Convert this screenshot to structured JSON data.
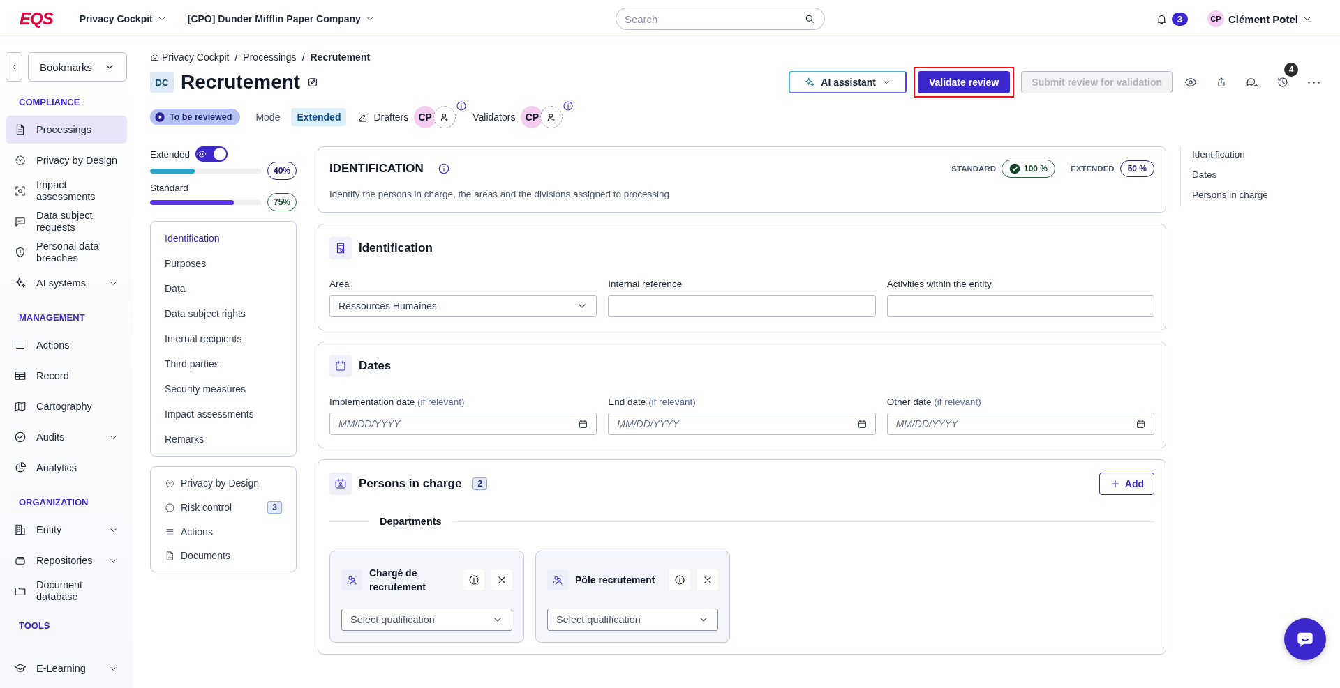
{
  "header": {
    "logo": "EQS",
    "module": "Privacy Cockpit",
    "company": "[CPO] Dunder Mifflin Paper Company",
    "search": {
      "placeholder": "Search"
    },
    "notifications": "3",
    "user": {
      "initials": "CP",
      "name": "Clément Potel"
    }
  },
  "sidebar": {
    "bookmarks": "Bookmarks",
    "sections": [
      {
        "title": "COMPLIANCE",
        "items": [
          {
            "label": "Processings",
            "selected": true,
            "expandable": false
          },
          {
            "label": "Privacy by Design",
            "selected": false,
            "expandable": false
          },
          {
            "label": "Impact assessments",
            "selected": false,
            "expandable": false
          },
          {
            "label": "Data subject requests",
            "selected": false,
            "expandable": false
          },
          {
            "label": "Personal data breaches",
            "selected": false,
            "expandable": false
          },
          {
            "label": "AI systems",
            "selected": false,
            "expandable": true
          }
        ]
      },
      {
        "title": "MANAGEMENT",
        "items": [
          {
            "label": "Actions",
            "selected": false,
            "expandable": false
          },
          {
            "label": "Record",
            "selected": false,
            "expandable": false
          },
          {
            "label": "Cartography",
            "selected": false,
            "expandable": false
          },
          {
            "label": "Audits",
            "selected": false,
            "expandable": true
          },
          {
            "label": "Analytics",
            "selected": false,
            "expandable": false
          }
        ]
      },
      {
        "title": "ORGANIZATION",
        "items": [
          {
            "label": "Entity",
            "selected": false,
            "expandable": true
          },
          {
            "label": "Repositories",
            "selected": false,
            "expandable": true
          },
          {
            "label": "Document database",
            "selected": false,
            "expandable": false
          }
        ]
      },
      {
        "title": "TOOLS",
        "items": [
          {
            "label": "E-Learning",
            "selected": false,
            "expandable": true
          }
        ]
      }
    ]
  },
  "page": {
    "breadcrumb": [
      {
        "label": "Privacy Cockpit",
        "current": false
      },
      {
        "label": "Processings",
        "current": false
      },
      {
        "label": "Recrutement",
        "current": true
      }
    ],
    "separator": "/",
    "badge": "DC",
    "title": "Recrutement",
    "actions": [
      {
        "kind": "dropdown",
        "label": "AI assistant",
        "highlighted": false,
        "disabled": false
      },
      {
        "kind": "primary",
        "label": "Validate review",
        "highlighted": true,
        "disabled": false
      },
      {
        "kind": "secondary",
        "label": "Submit review for validation",
        "highlighted": false,
        "disabled": true
      }
    ],
    "history_count": "4",
    "status": "To be reviewed",
    "mode_label": "Mode",
    "mode": "Extended",
    "roles": [
      {
        "label": "Drafters",
        "initials": "CP"
      },
      {
        "label": "Validators",
        "initials": "CP"
      }
    ]
  },
  "progress": {
    "toggle": {
      "label": "Extended",
      "on": true
    },
    "bars": [
      {
        "level": 0.4,
        "reading": "40%",
        "color": "#2ea3c9"
      },
      {
        "label": "Standard",
        "level": 0.75,
        "reading": "75%",
        "color": "#5b33f0"
      }
    ],
    "nav": [
      {
        "label": "Identification",
        "selected": true
      },
      {
        "label": "Purposes",
        "selected": false
      },
      {
        "label": "Data",
        "selected": false
      },
      {
        "label": "Data subject rights",
        "selected": false
      },
      {
        "label": "Internal recipients",
        "selected": false
      },
      {
        "label": "Third parties",
        "selected": false
      },
      {
        "label": "Security measures",
        "selected": false
      },
      {
        "label": "Impact assessments",
        "selected": false
      },
      {
        "label": "Remarks",
        "selected": false
      }
    ],
    "links": [
      {
        "label": "Privacy by Design"
      },
      {
        "label": "Risk control",
        "count": "3"
      },
      {
        "label": "Actions"
      },
      {
        "label": "Documents"
      }
    ]
  },
  "summary": {
    "title": "IDENTIFICATION",
    "description": "Identify the persons in charge, the areas and the divisions assigned to processing",
    "scores": [
      {
        "label": "STANDARD",
        "value": "100 %",
        "complete": true
      },
      {
        "label": "EXTENDED",
        "value": "50 %",
        "complete": false
      }
    ]
  },
  "cards": [
    {
      "kind": "fields",
      "title": "Identification",
      "fields": [
        {
          "kind": "select",
          "label": "Area",
          "value": "Ressources Humaines"
        },
        {
          "kind": "text",
          "label": "Internal reference"
        },
        {
          "kind": "text",
          "label": "Activities within the entity"
        }
      ]
    },
    {
      "kind": "fields",
      "title": "Dates",
      "fields": [
        {
          "kind": "date",
          "label": "Implementation date",
          "hint": "(if relevant)",
          "placeholder": "MM/DD/YYYY"
        },
        {
          "kind": "date",
          "label": "End date",
          "hint": "(if relevant)",
          "placeholder": "MM/DD/YYYY"
        },
        {
          "kind": "date",
          "label": "Other date",
          "hint": "(if relevant)",
          "placeholder": "MM/DD/YYYY"
        }
      ]
    },
    {
      "kind": "persons",
      "title": "Persons in charge",
      "count": "2",
      "add": "Add",
      "group": "Departments",
      "persons": [
        {
          "name": "Chargé de recrutement",
          "placeholder": "Select qualification"
        },
        {
          "name": "Pôle recrutement",
          "placeholder": "Select qualification"
        }
      ]
    }
  ],
  "toc": [
    {
      "label": "Identification"
    },
    {
      "label": "Dates"
    },
    {
      "label": "Persons in charge"
    }
  ]
}
